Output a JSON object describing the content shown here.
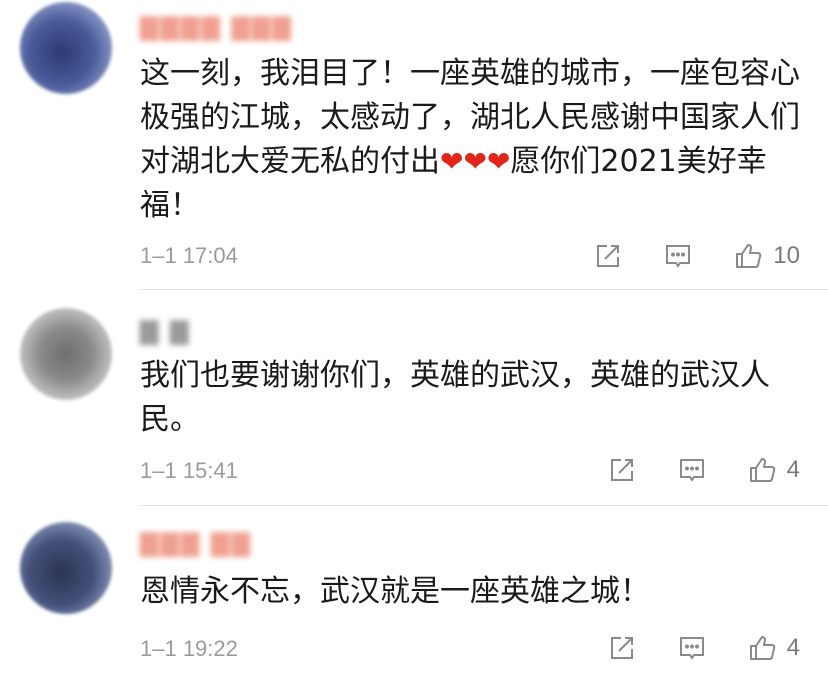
{
  "comments": [
    {
      "username": "▇▇▇▇ ▇▇▇",
      "text_before_hearts": "这一刻，我泪目了！一座英雄的城市，一座包容心极强的江城，太感动了，湖北人民感谢中国家人们对湖北大爱无私的付出",
      "hearts": "❤❤❤",
      "text_after_hearts": "愿你们2021美好幸福！",
      "time": "1–1 17:04",
      "likes": "10"
    },
    {
      "username": "▇ ▇",
      "text": "我们也要谢谢你们，英雄的武汉，英雄的武汉人民。",
      "time": "1–1 15:41",
      "likes": "4"
    },
    {
      "username": "▇▇▇ ▇▇",
      "text": "恩情永不忘，武汉就是一座英雄之城！",
      "time": "1–1 19:22",
      "likes": "4"
    }
  ],
  "icons": {
    "share": "share-icon",
    "reply": "comment-icon",
    "like": "thumbs-up-icon"
  },
  "colors": {
    "heart": "#e1251b",
    "meta_text": "#9b9b9b",
    "divider": "#e6e6e6"
  }
}
